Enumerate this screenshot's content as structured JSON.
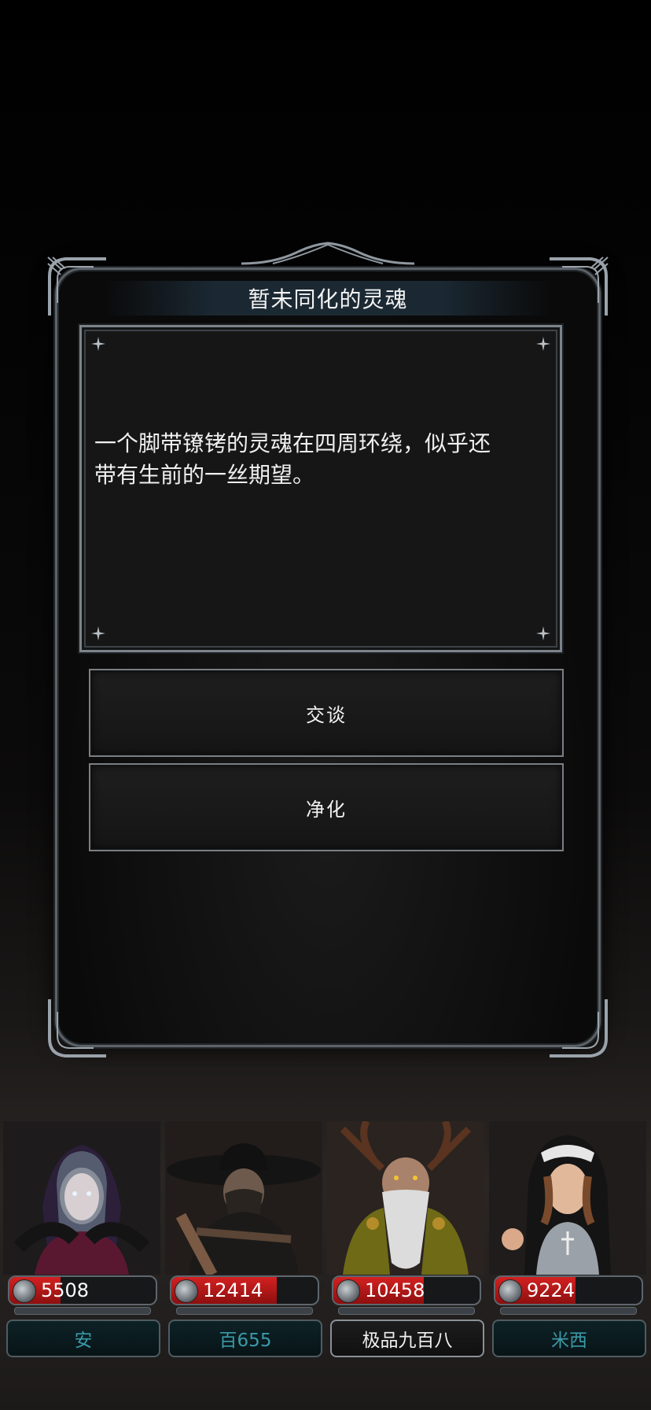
{
  "dialog": {
    "title": "暂未同化的灵魂",
    "body_line_1": "一个脚带镣铐的灵魂在四周环绕，似乎还",
    "body_line_2": "带有生前的一丝期望。",
    "choices": [
      {
        "label": "交谈"
      },
      {
        "label": "净化"
      }
    ]
  },
  "party": [
    {
      "name": "安",
      "hp": "5508",
      "hp_fraction": 0.35,
      "portrait": "hooded-sorceress",
      "active": false
    },
    {
      "name": "百655",
      "hp": "12414",
      "hp_fraction": 0.72,
      "portrait": "hat-swordsman",
      "active": false
    },
    {
      "name": "极品九百八",
      "hp": "10458",
      "hp_fraction": 0.62,
      "portrait": "antlered-elder",
      "active": true
    },
    {
      "name": "米西",
      "hp": "9224",
      "hp_fraction": 0.55,
      "portrait": "nun-warrior",
      "active": false
    }
  ],
  "colors": {
    "hp_bar": "#c81b1b",
    "inactive_name": "#3a9aa8",
    "frame": "#7c848b"
  }
}
